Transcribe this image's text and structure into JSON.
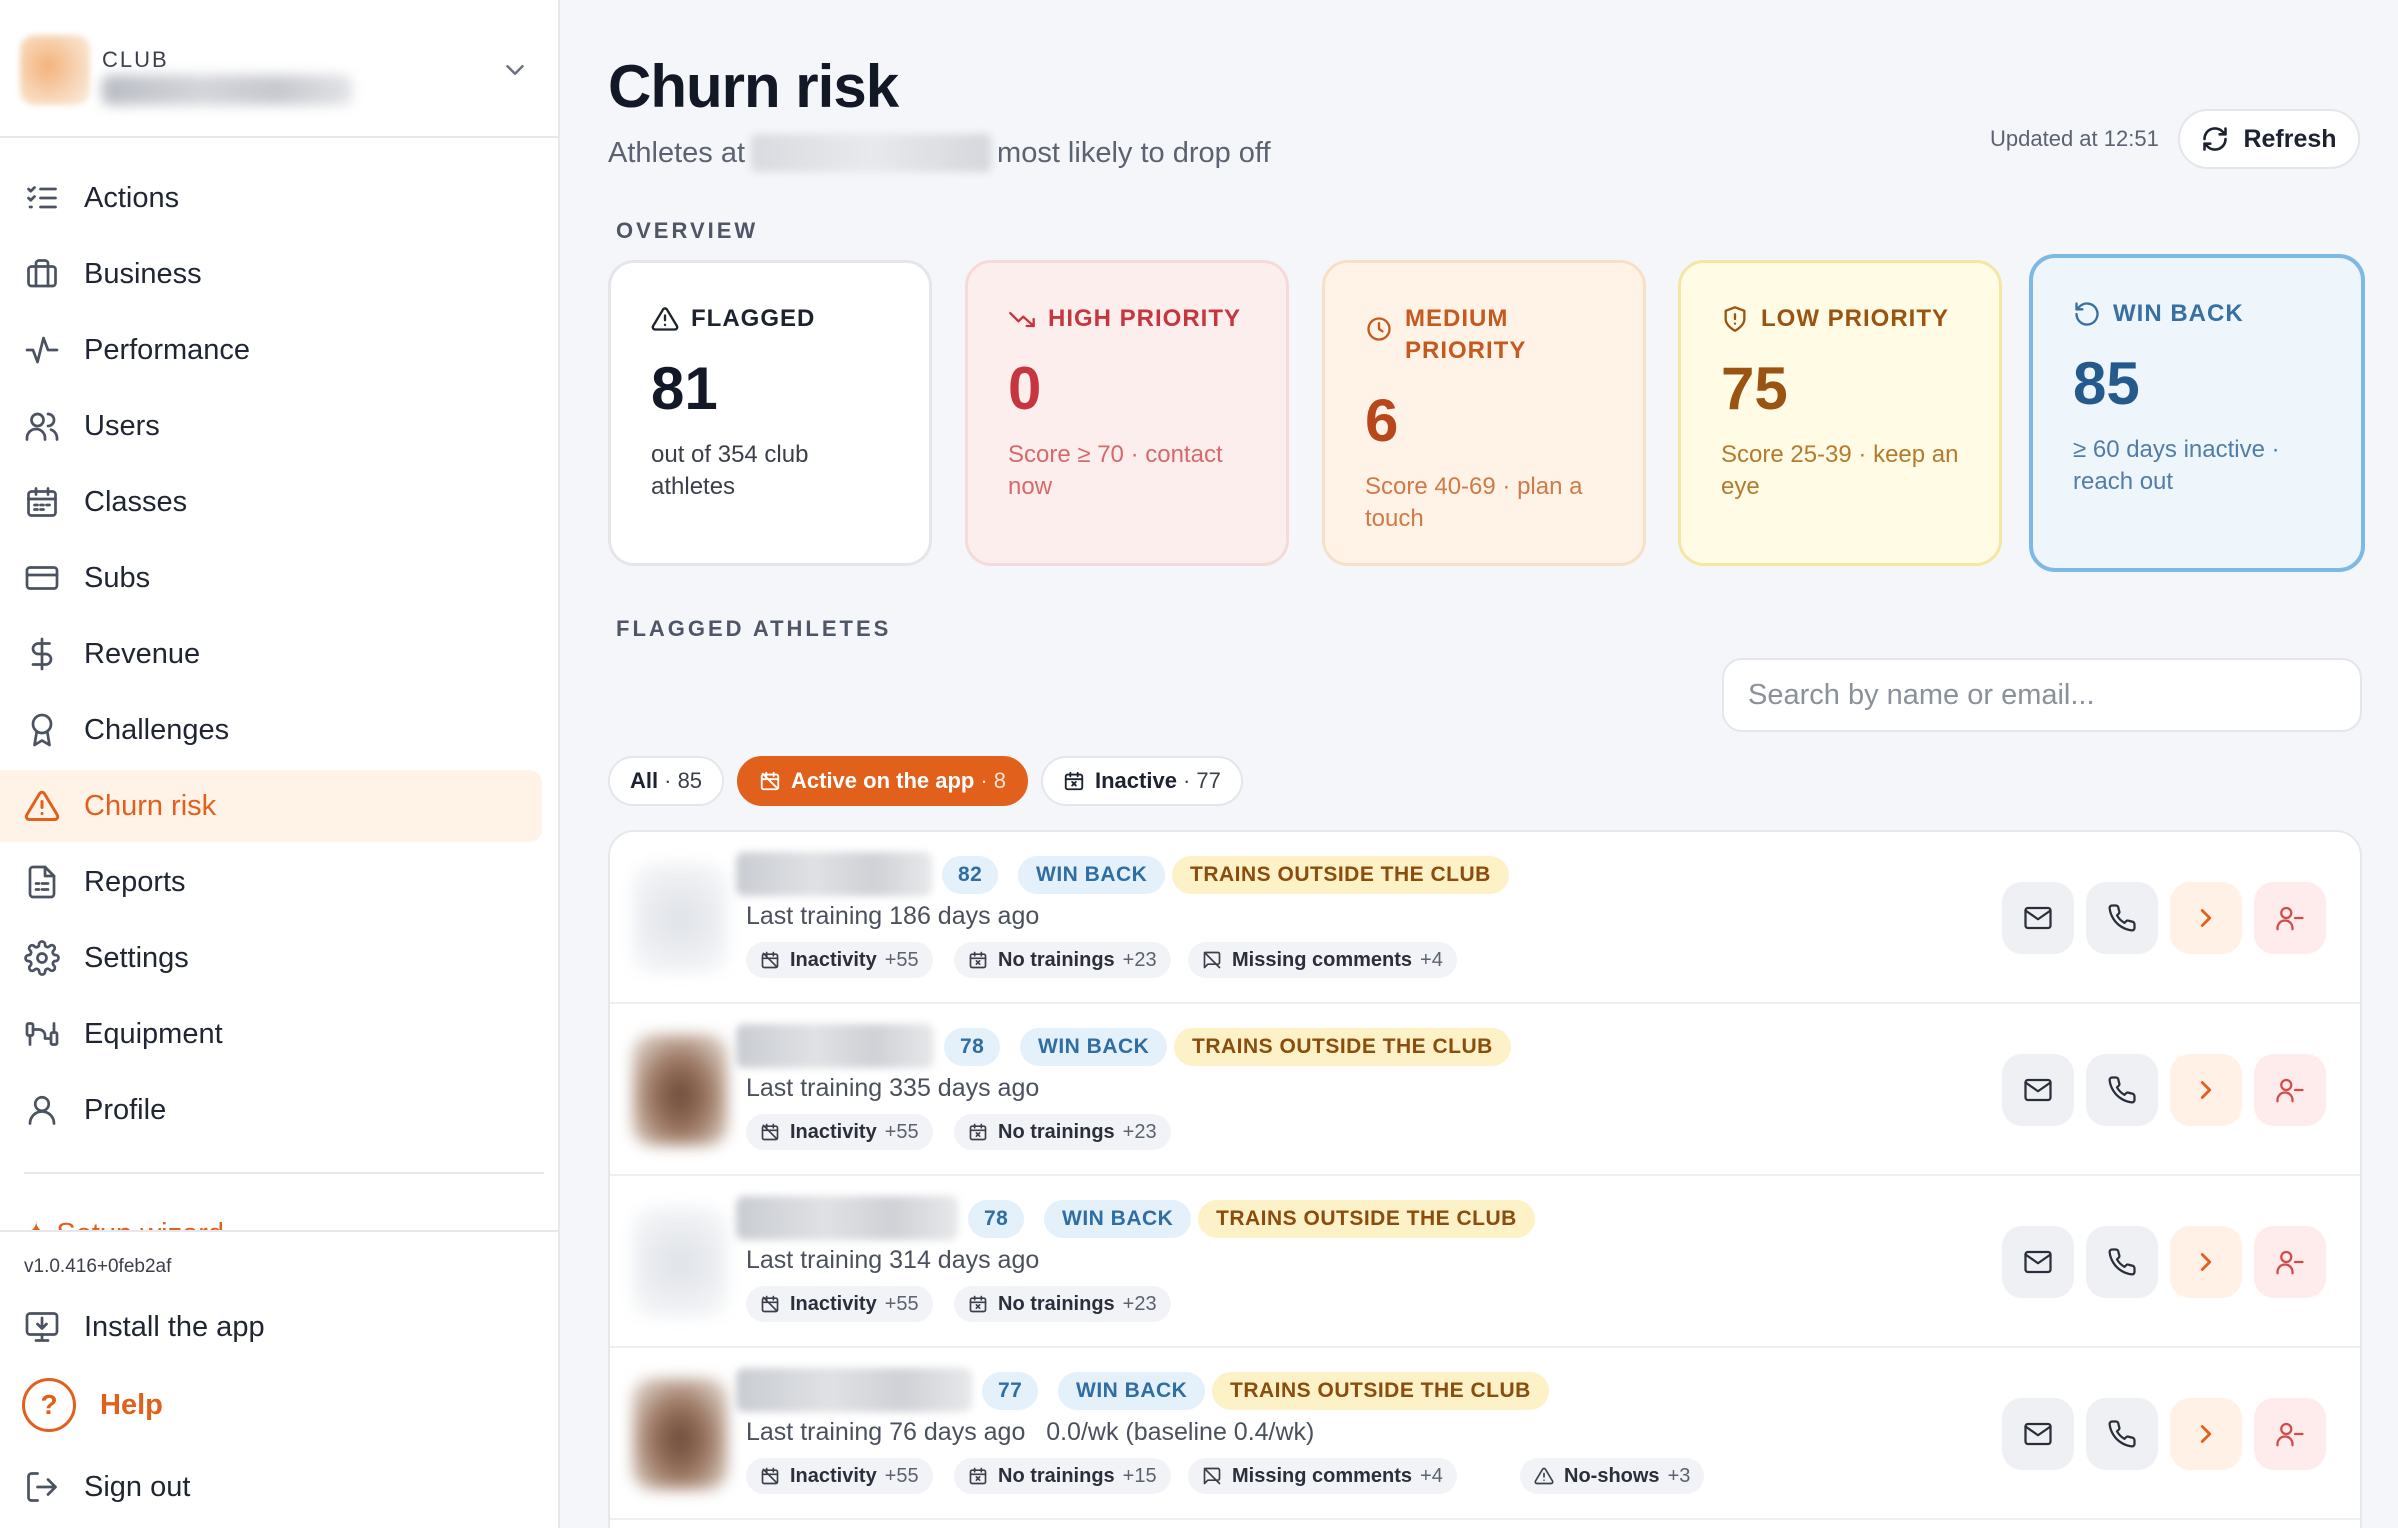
{
  "sidebar": {
    "club_tag": "CLUB",
    "nav": [
      {
        "label": "Actions",
        "icon": "list-checks-icon"
      },
      {
        "label": "Business",
        "icon": "briefcase-icon"
      },
      {
        "label": "Performance",
        "icon": "activity-icon"
      },
      {
        "label": "Users",
        "icon": "users-icon"
      },
      {
        "label": "Classes",
        "icon": "calendar-icon"
      },
      {
        "label": "Subs",
        "icon": "credit-card-icon"
      },
      {
        "label": "Revenue",
        "icon": "dollar-icon"
      },
      {
        "label": "Challenges",
        "icon": "award-icon"
      },
      {
        "label": "Churn risk",
        "icon": "alert-triangle-icon",
        "active": true
      },
      {
        "label": "Reports",
        "icon": "file-text-icon"
      },
      {
        "label": "Settings",
        "icon": "gear-icon"
      },
      {
        "label": "Equipment",
        "icon": "dumbbell-icon"
      },
      {
        "label": "Profile",
        "icon": "user-icon"
      }
    ],
    "setup_wizard": "Setup wizard",
    "version": "v1.0.416+0feb2af",
    "install": "Install the app",
    "help": "Help",
    "help_glyph": "?",
    "signout": "Sign out"
  },
  "header": {
    "title": "Churn risk",
    "subtitle_prefix": "Athletes at",
    "subtitle_suffix": "most likely to drop off",
    "updated": "Updated at 12:51",
    "refresh": "Refresh"
  },
  "overview": {
    "label": "OVERVIEW",
    "flagged": {
      "title": "FLAGGED",
      "value": "81",
      "desc": "out of 354 club athletes"
    },
    "high": {
      "title": "HIGH PRIORITY",
      "value": "0",
      "desc": "Score ≥ 70 · contact now"
    },
    "medium": {
      "title": "MEDIUM PRIORITY",
      "value": "6",
      "desc": "Score 40-69 · plan a touch"
    },
    "low": {
      "title": "LOW PRIORITY",
      "value": "75",
      "desc": "Score 25-39 · keep an eye"
    },
    "winback": {
      "title": "WIN BACK",
      "value": "85",
      "desc": "≥ 60 days inactive · reach out"
    }
  },
  "flagged_section": {
    "label": "FLAGGED ATHLETES",
    "search_placeholder": "Search by name or email...",
    "filters": {
      "all": {
        "label": "All",
        "count": "· 85"
      },
      "active": {
        "label": "Active on the app",
        "count": "· 8"
      },
      "inactive": {
        "label": "Inactive",
        "count": "· 77"
      }
    }
  },
  "athletes": [
    {
      "score": "82",
      "tag_win": "WIN BACK",
      "tag_outside": "TRAINS OUTSIDE THE CLUB",
      "last_training": "Last training 186 days ago",
      "factors": [
        {
          "label": "Inactivity",
          "pts": "+55"
        },
        {
          "label": "No trainings",
          "pts": "+23"
        },
        {
          "label": "Missing comments",
          "pts": "+4"
        }
      ]
    },
    {
      "score": "78",
      "tag_win": "WIN BACK",
      "tag_outside": "TRAINS OUTSIDE THE CLUB",
      "last_training": "Last training 335 days ago",
      "factors": [
        {
          "label": "Inactivity",
          "pts": "+55"
        },
        {
          "label": "No trainings",
          "pts": "+23"
        }
      ]
    },
    {
      "score": "78",
      "tag_win": "WIN BACK",
      "tag_outside": "TRAINS OUTSIDE THE CLUB",
      "last_training": "Last training 314 days ago",
      "factors": [
        {
          "label": "Inactivity",
          "pts": "+55"
        },
        {
          "label": "No trainings",
          "pts": "+23"
        }
      ]
    },
    {
      "score": "77",
      "tag_win": "WIN BACK",
      "tag_outside": "TRAINS OUTSIDE THE CLUB",
      "last_training": "Last training 76 days ago   0.0/wk (baseline 0.4/wk)",
      "factors": [
        {
          "label": "Inactivity",
          "pts": "+55"
        },
        {
          "label": "No trainings",
          "pts": "+15"
        },
        {
          "label": "Missing comments",
          "pts": "+4"
        },
        {
          "label": "No-shows",
          "pts": "+3"
        }
      ]
    }
  ],
  "colors": {
    "accent": "#e1601c",
    "high": "#c6363f",
    "win_back": "#2f6ea3",
    "low": "#9a5412"
  }
}
